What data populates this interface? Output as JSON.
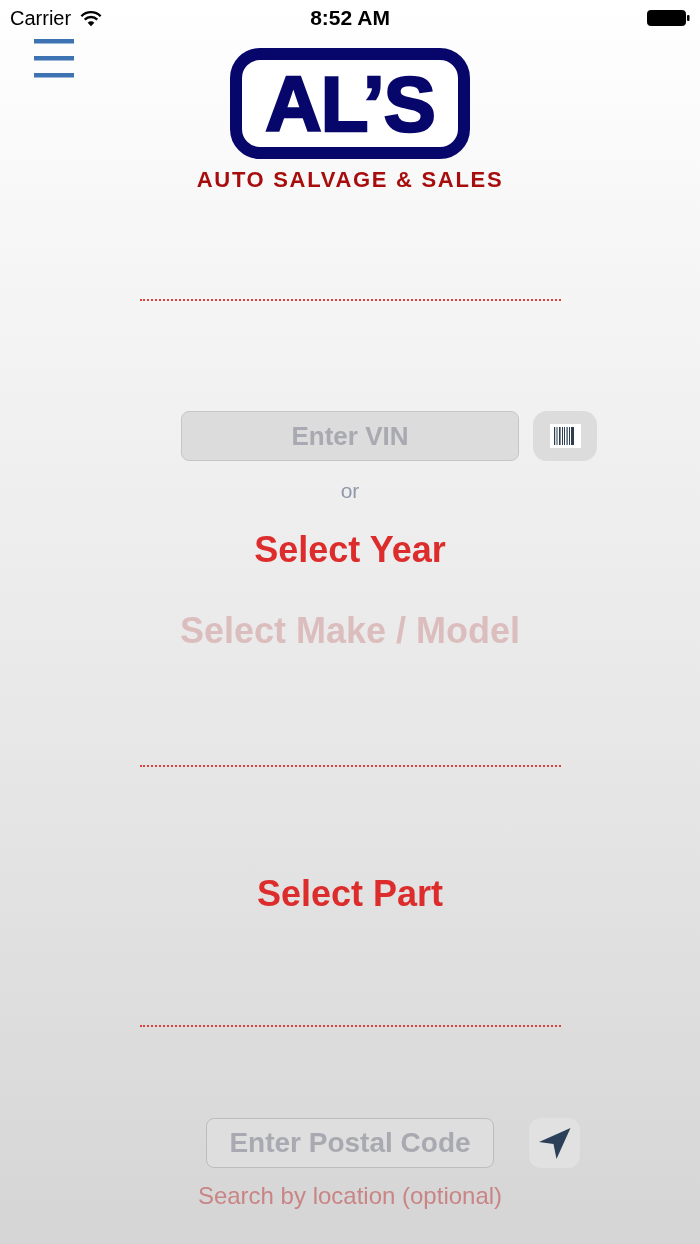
{
  "status_bar": {
    "carrier": "Carrier",
    "time": "8:52 AM"
  },
  "logo": {
    "wordmark": "AL’S",
    "tagline": "AUTO SALVAGE & SALES"
  },
  "vin_search": {
    "placeholder": "Enter VIN"
  },
  "separator": "or",
  "vehicle_pickers": [
    {
      "label": "Select Year",
      "disabled": false
    },
    {
      "label": "Select Make / Model",
      "disabled": true
    }
  ],
  "part_picker": {
    "label": "Select Part",
    "disabled": false
  },
  "location_search": {
    "placeholder": "Enter Postal Code",
    "hint": "Search by location (optional)"
  }
}
